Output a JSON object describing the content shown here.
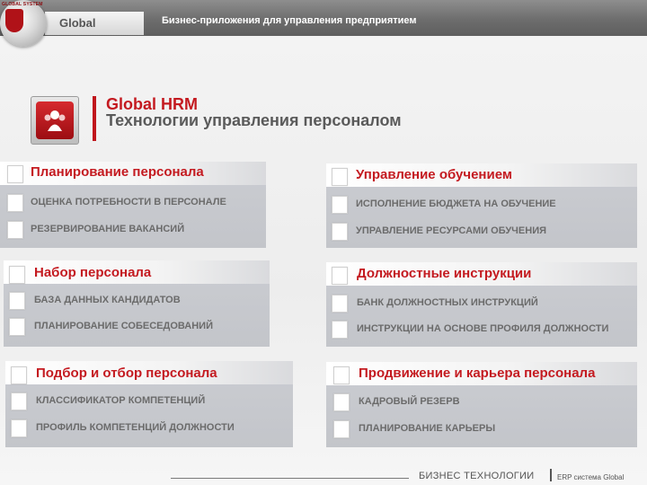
{
  "topbar": {
    "logo_text": "GLOBAL SYSTEM",
    "brand": "Global",
    "title": "Бизнес-приложения для управления предприятием"
  },
  "header": {
    "title": "Global HRM",
    "subtitle": "Технологии управления персоналом"
  },
  "panels": [
    {
      "heading": "Планирование персонала",
      "items": [
        "ОЦЕНКА ПОТРЕБНОСТИ В ПЕРСОНАЛЕ",
        "РЕЗЕРВИРОВАНИЕ ВАКАНСИЙ"
      ]
    },
    {
      "heading": "Управление обучением",
      "items": [
        "ИСПОЛНЕНИЕ БЮДЖЕТА НА ОБУЧЕНИЕ",
        "УПРАВЛЕНИЕ РЕСУРСАМИ ОБУЧЕНИЯ"
      ]
    },
    {
      "heading": "Набор персонала",
      "items": [
        "БАЗА ДАННЫХ КАНДИДАТОВ",
        "ПЛАНИРОВАНИЕ СОБЕСЕДОВАНИЙ"
      ]
    },
    {
      "heading": "Должностные инструкции",
      "items": [
        "БАНК ДОЛЖНОСТНЫХ ИНСТРУКЦИЙ",
        "ИНСТРУКЦИИ НА ОСНОВЕ ПРОФИЛЯ ДОЛЖНОСТИ"
      ]
    },
    {
      "heading": "Подбор и отбор персонала",
      "items": [
        "КЛАССИФИКАТОР КОМПЕТЕНЦИЙ",
        "ПРОФИЛЬ КОМПЕТЕНЦИЙ ДОЛЖНОСТИ"
      ]
    },
    {
      "heading": "Продвижение и карьера персонала",
      "items": [
        "КАДРОВЫЙ РЕЗЕРВ",
        "ПЛАНИРОВАНИЕ КАРЬЕРЫ"
      ]
    }
  ],
  "footer": {
    "company": "БИЗНЕС ТЕХНОЛОГИИ",
    "product": "ERP система Global"
  },
  "colors": {
    "accent_red": "#c41a20",
    "panel_gray": "#c6c8cd",
    "topbar_gray": "#6d6d6d"
  },
  "icons": {
    "app_icon": "people-group-icon",
    "checkbox": "checkbox-icon"
  }
}
